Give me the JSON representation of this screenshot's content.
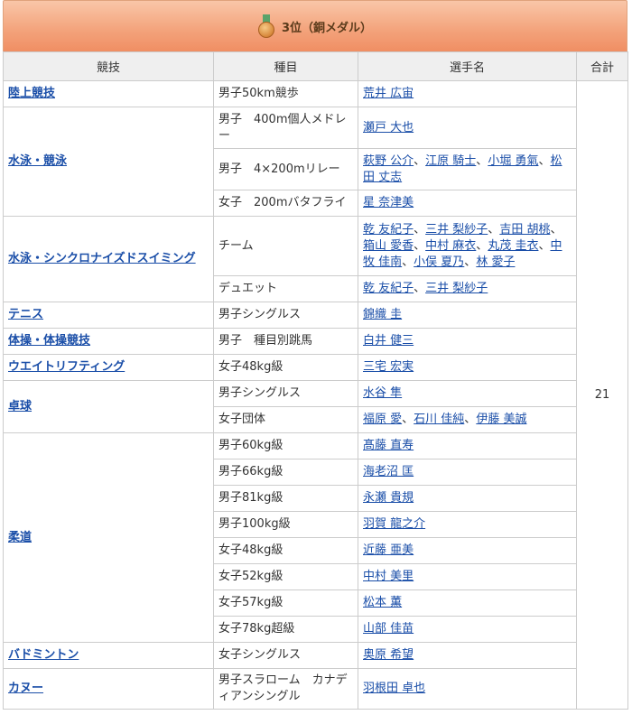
{
  "header": {
    "title": "3位（銅メダル）",
    "medal_icon": "bronze-medal-icon",
    "colors": {
      "bar_top": "#f9c6a8",
      "bar_bottom": "#f08e63",
      "link": "#1a4ea8"
    }
  },
  "table": {
    "headers": {
      "sport": "競技",
      "event": "種目",
      "athletes": "選手名",
      "total": "合計"
    },
    "total": "21",
    "sports": [
      {
        "name": "陸上競技",
        "events": [
          {
            "event": "男子50km競歩",
            "athletes": [
              "荒井 広宙"
            ]
          }
        ]
      },
      {
        "name": "水泳・競泳",
        "events": [
          {
            "event": "男子　400m個人メドレー",
            "athletes": [
              "瀬戸 大也"
            ]
          },
          {
            "event": "男子　4×200mリレー",
            "athletes": [
              "萩野 公介",
              "江原 騎士",
              "小堀 勇氣",
              "松田 丈志"
            ]
          },
          {
            "event": "女子　200mバタフライ",
            "athletes": [
              "星 奈津美"
            ]
          }
        ]
      },
      {
        "name": "水泳・シンクロナイズドスイミング",
        "events": [
          {
            "event": "チーム",
            "athletes": [
              "乾 友紀子",
              "三井 梨紗子",
              "吉田 胡桃",
              "箱山 愛香",
              "中村 麻衣",
              "丸茂 圭衣",
              "中牧 佳南",
              "小俣 夏乃",
              "林 愛子"
            ]
          },
          {
            "event": "デュエット",
            "athletes": [
              "乾 友紀子",
              "三井 梨紗子"
            ]
          }
        ]
      },
      {
        "name": "テニス",
        "events": [
          {
            "event": "男子シングルス",
            "athletes": [
              "錦織 圭"
            ]
          }
        ]
      },
      {
        "name": "体操・体操競技",
        "events": [
          {
            "event": "男子　種目別跳馬",
            "athletes": [
              "白井 健三"
            ]
          }
        ]
      },
      {
        "name": "ウエイトリフティング",
        "events": [
          {
            "event": "女子48kg級",
            "athletes": [
              "三宅 宏実"
            ]
          }
        ]
      },
      {
        "name": "卓球",
        "events": [
          {
            "event": "男子シングルス",
            "athletes": [
              "水谷 隼"
            ]
          },
          {
            "event": "女子団体",
            "athletes": [
              "福原 愛",
              "石川 佳純",
              "伊藤 美誠"
            ]
          }
        ]
      },
      {
        "name": "柔道",
        "events": [
          {
            "event": "男子60kg級",
            "athletes": [
              "髙藤 直寿"
            ]
          },
          {
            "event": "男子66kg級",
            "athletes": [
              "海老沼 匡"
            ]
          },
          {
            "event": "男子81kg級",
            "athletes": [
              "永瀬 貴規"
            ]
          },
          {
            "event": "男子100kg級",
            "athletes": [
              "羽賀 龍之介"
            ]
          },
          {
            "event": "女子48kg級",
            "athletes": [
              "近藤 亜美"
            ]
          },
          {
            "event": "女子52kg級",
            "athletes": [
              "中村 美里"
            ]
          },
          {
            "event": "女子57kg級",
            "athletes": [
              "松本 薫"
            ]
          },
          {
            "event": "女子78kg超級",
            "athletes": [
              "山部 佳苗"
            ]
          }
        ]
      },
      {
        "name": "バドミントン",
        "events": [
          {
            "event": "女子シングルス",
            "athletes": [
              "奥原 希望"
            ]
          }
        ]
      },
      {
        "name": "カヌー",
        "events": [
          {
            "event": "男子スラローム　カナディアンシングル",
            "athletes": [
              "羽根田 卓也"
            ]
          }
        ]
      }
    ]
  }
}
